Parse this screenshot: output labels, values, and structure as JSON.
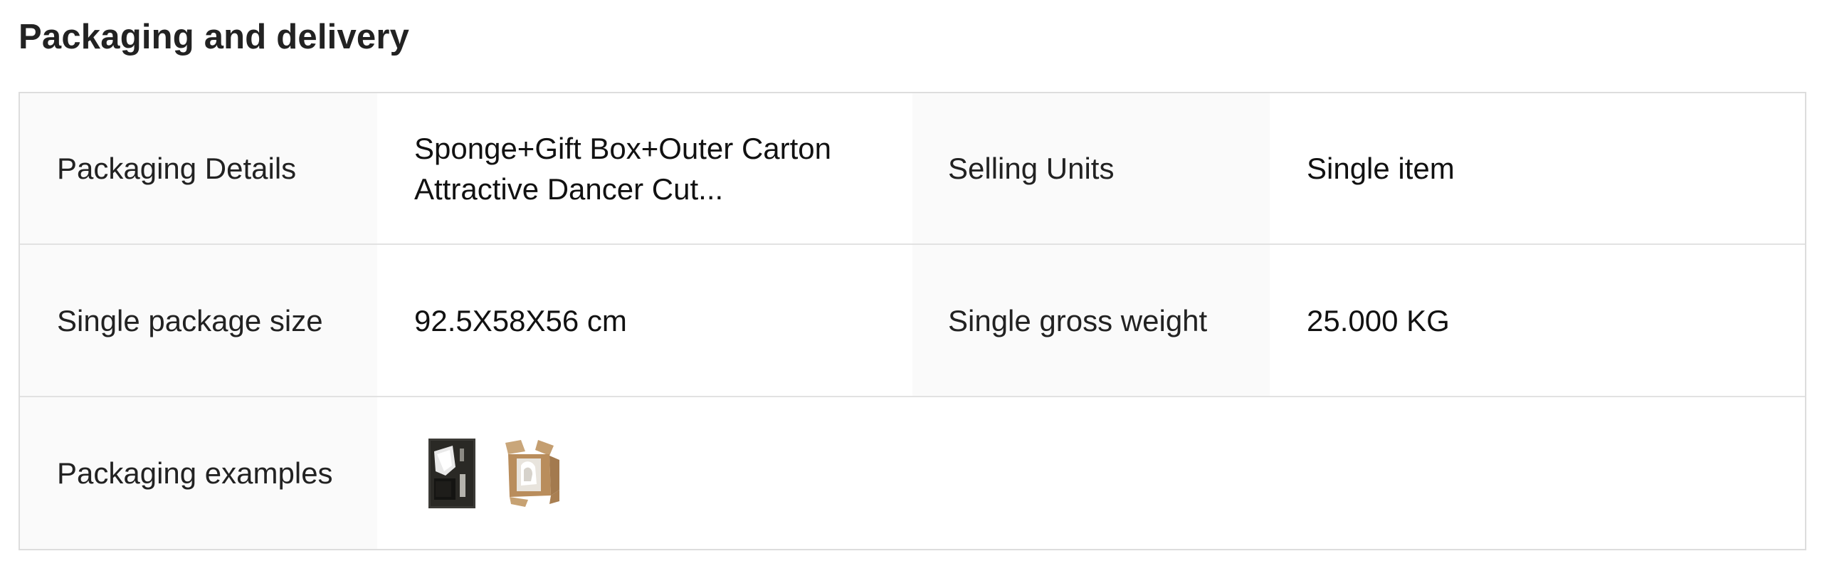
{
  "section": {
    "title": "Packaging and delivery"
  },
  "rows": [
    {
      "label_1": "Packaging Details",
      "value_1": "Sponge+Gift Box+Outer Carton Attractive Dancer Cut...",
      "label_2": "Selling Units",
      "value_2": "Single item"
    },
    {
      "label_1": "Single package size",
      "value_1": "92.5X58X56 cm",
      "label_2": "Single gross weight",
      "value_2": "25.000 KG"
    },
    {
      "label_1": "Packaging examples",
      "thumbnails": [
        {
          "icon": "foam-insert-package-thumbnail-icon"
        },
        {
          "icon": "carton-box-package-thumbnail-icon"
        }
      ]
    }
  ],
  "colors": {
    "label_bg": "#fafafa",
    "border": "#dddddd",
    "text": "#222222"
  }
}
